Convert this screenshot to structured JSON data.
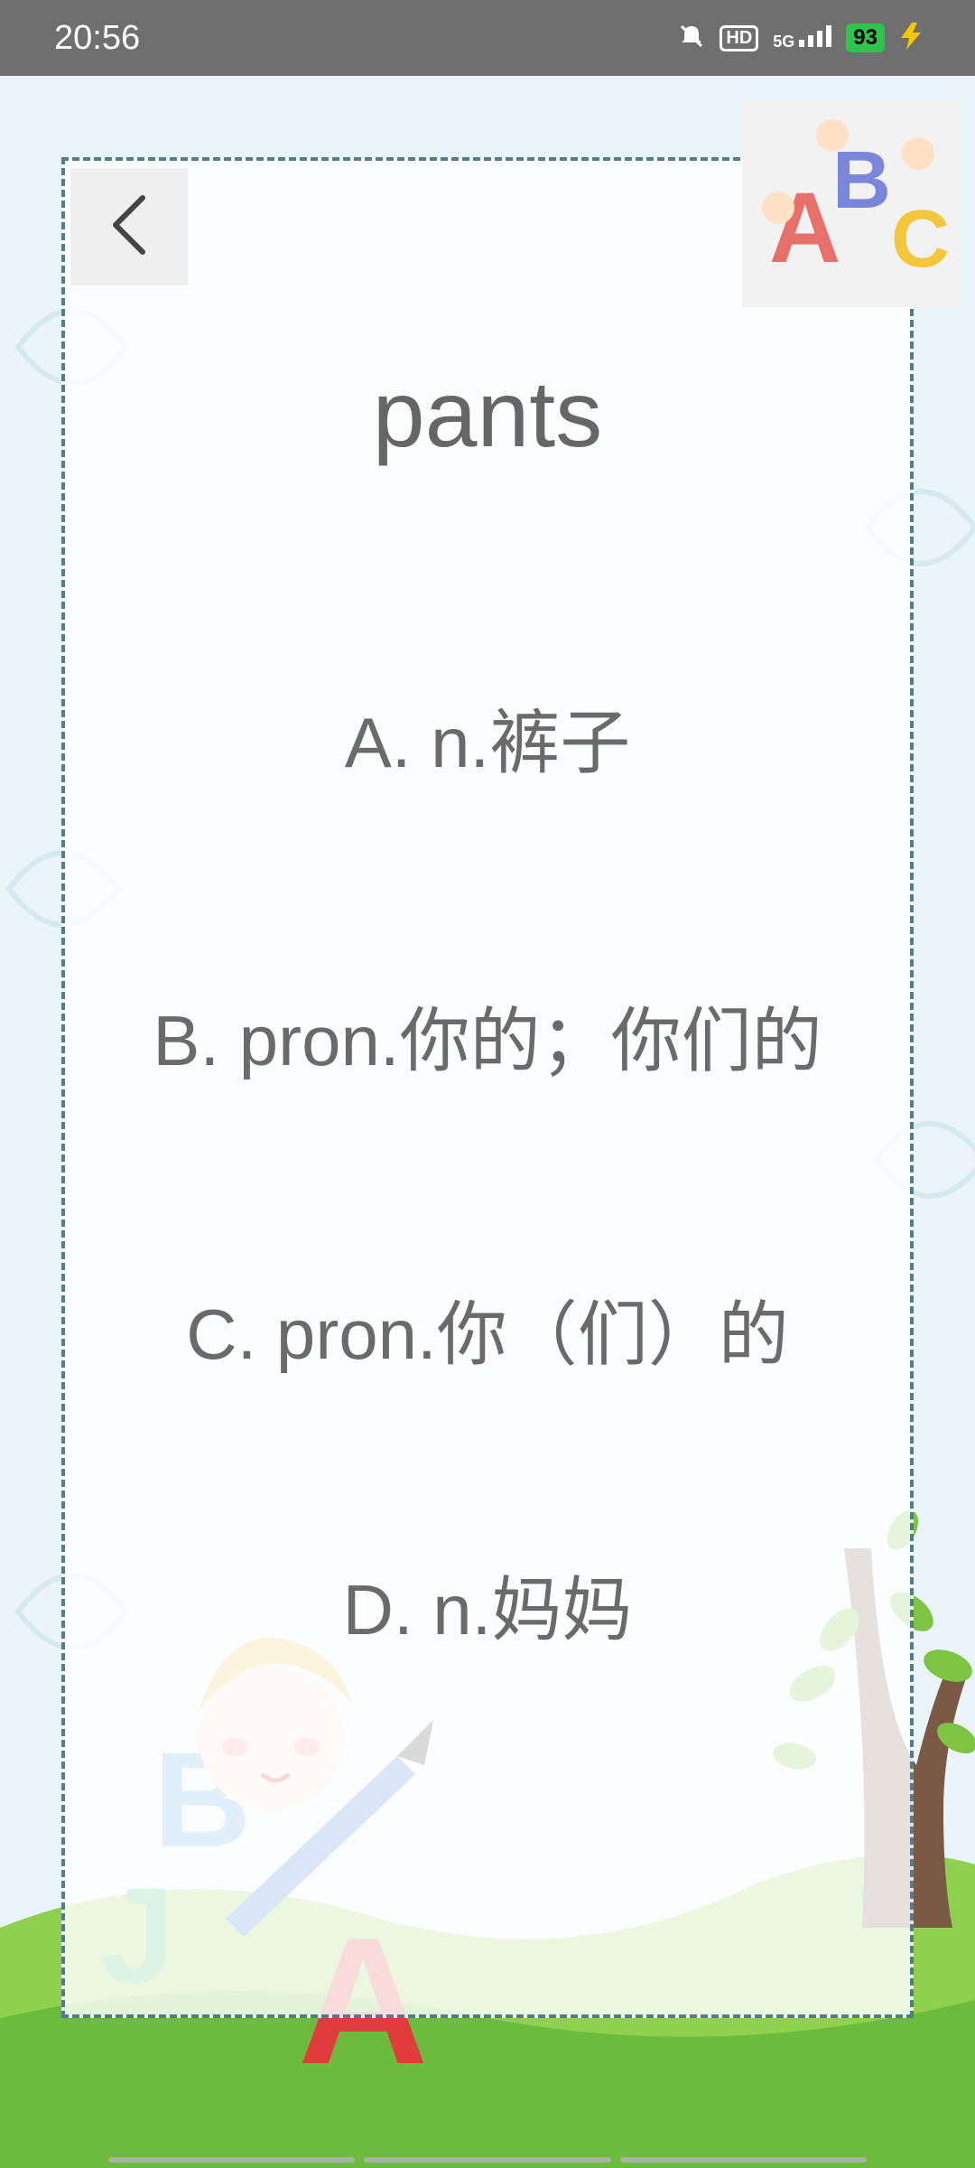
{
  "status_bar": {
    "time": "20:56",
    "battery": "93",
    "hd_label": "HD",
    "network": "5G",
    "icons": [
      "mute-icon",
      "hd-icon",
      "signal-icon",
      "battery-icon",
      "charging-icon"
    ]
  },
  "quiz": {
    "word": "pants",
    "options": [
      {
        "label": "A. n.裤子"
      },
      {
        "label": "B. pron.你的；你们的"
      },
      {
        "label": "C. pron.你（们）的"
      },
      {
        "label": "D. n.妈妈"
      }
    ]
  },
  "colors": {
    "status_bar": "#6f6f6f",
    "background": "#e9f5fa",
    "card_border": "#4f7d8e",
    "text": "#6a6a6a",
    "grass": "#7cc441"
  }
}
